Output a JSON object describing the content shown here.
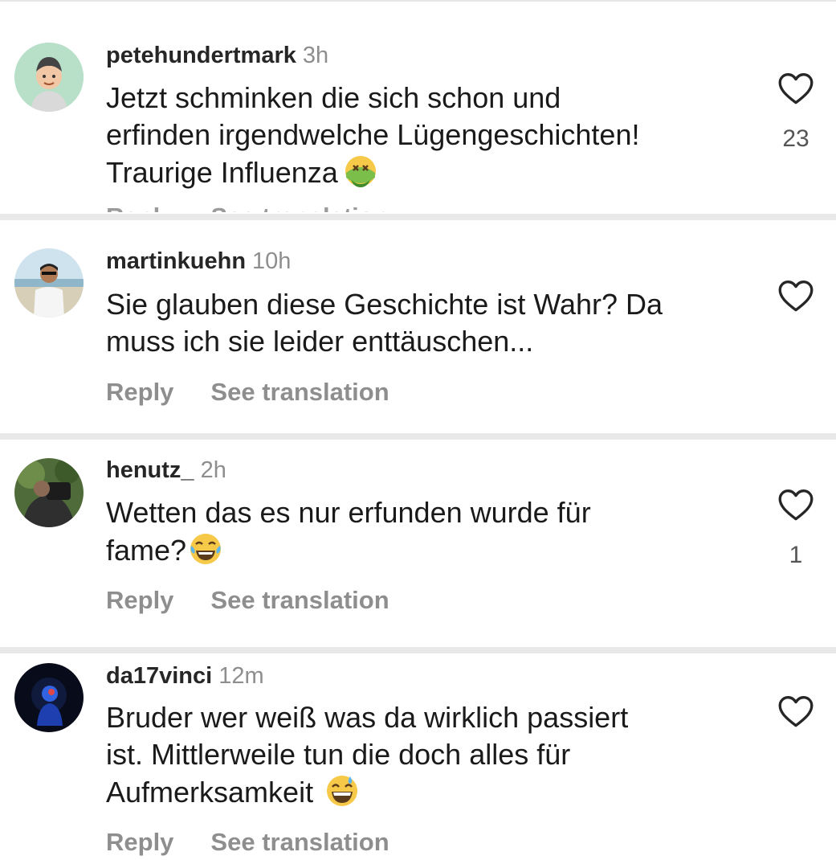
{
  "comments": [
    {
      "username": "petehundertmark",
      "time": "3h",
      "lines": [
        "Jetzt schminken die sich schon und",
        "erfinden irgendwelche Lügengeschichten!",
        "Traurige Influenza"
      ],
      "emoji": "nauseated-face-icon",
      "likes": "23",
      "actions": {
        "reply": "Reply",
        "translate": "See translation"
      }
    },
    {
      "username": "martinkuehn",
      "time": "10h",
      "lines": [
        "Sie glauben diese Geschichte ist Wahr? Da",
        "muss ich sie leider enttäuschen..."
      ],
      "likes": "",
      "actions": {
        "reply": "Reply",
        "translate": "See translation"
      }
    },
    {
      "username": "henutz_",
      "time": "2h",
      "lines": [
        "Wetten das es nur erfunden wurde für",
        "fame?"
      ],
      "emoji": "tears-of-joy-icon",
      "likes": "1",
      "actions": {
        "reply": "Reply",
        "translate": "See translation"
      }
    },
    {
      "username": "da17vinci",
      "time": "12m",
      "lines": [
        "Bruder wer weiß was da wirklich passiert",
        "ist. Mittlerweile tun die doch alles für",
        "Aufmerksamkeit"
      ],
      "emoji": "grinning-sweat-icon",
      "likes": "",
      "actions": {
        "reply": "Reply",
        "translate": "See translation"
      }
    }
  ],
  "colors": {
    "text": "#1a1a1a",
    "username": "#262626",
    "muted": "#8e8e8e",
    "separator": "#e9e9e9"
  }
}
